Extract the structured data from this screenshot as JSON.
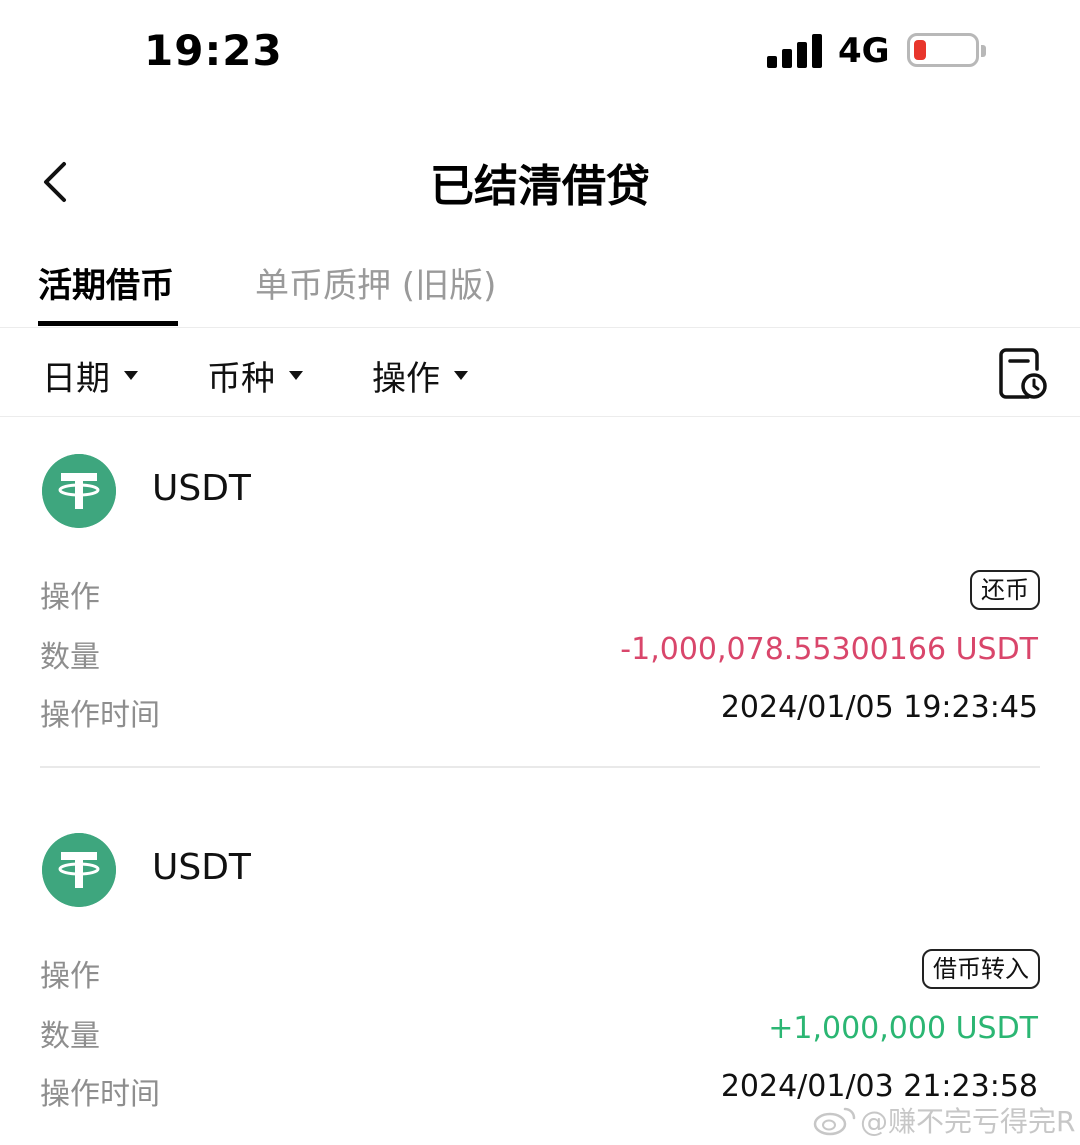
{
  "status_bar": {
    "time": "19:23",
    "network": "4G"
  },
  "header": {
    "title": "已结清借贷"
  },
  "tabs": [
    {
      "label": "活期借币"
    },
    {
      "label": "单币质押 (旧版)"
    }
  ],
  "filters": [
    {
      "label": "日期"
    },
    {
      "label": "币种"
    },
    {
      "label": "操作"
    }
  ],
  "records": [
    {
      "coin": "USDT",
      "action_label": "操作",
      "action_value": "还币",
      "amount_label": "数量",
      "amount_value": "-1,000,078.55300166 USDT",
      "time_label": "操作时间",
      "time_value": "2024/01/05 19:23:45"
    },
    {
      "coin": "USDT",
      "action_label": "操作",
      "action_value": "借币转入",
      "amount_label": "数量",
      "amount_value": "+1,000,000 USDT",
      "time_label": "操作时间",
      "time_value": "2024/01/03 21:23:58"
    }
  ],
  "watermark": {
    "text": "@赚不完亏得完R"
  },
  "colors": {
    "usdt": "#3ea67e",
    "negative": "#d9466b",
    "positive": "#2bb673",
    "battery_low": "#e8352b"
  }
}
